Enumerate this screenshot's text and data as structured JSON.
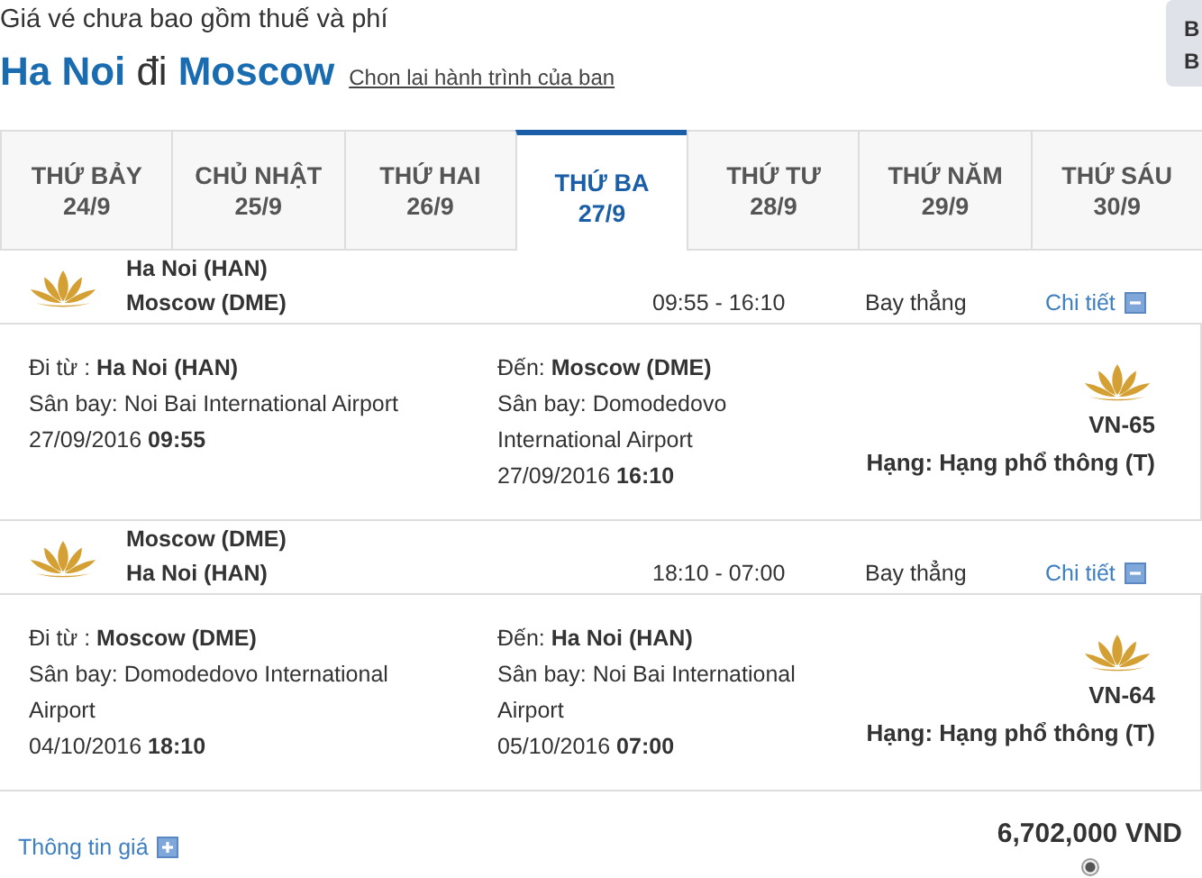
{
  "note": "Giá vé chưa bao gồm thuế và phí",
  "route": {
    "from": "Ha Noi",
    "joiner": "đi",
    "to": "Moscow",
    "change_link": "Chon lai hành trình của ban"
  },
  "tooltip": {
    "lines": [
      "B",
      "B"
    ]
  },
  "tabs": [
    {
      "day": "THỨ BẢY",
      "date": "24/9",
      "selected": false
    },
    {
      "day": "CHỦ NHẬT",
      "date": "25/9",
      "selected": false
    },
    {
      "day": "THỨ HAI",
      "date": "26/9",
      "selected": false
    },
    {
      "day": "THỨ BA",
      "date": "27/9",
      "selected": true
    },
    {
      "day": "THỨ TƯ",
      "date": "28/9",
      "selected": false
    },
    {
      "day": "THỨ NĂM",
      "date": "29/9",
      "selected": false
    },
    {
      "day": "THỨ SÁU",
      "date": "30/9",
      "selected": false
    }
  ],
  "flights": [
    {
      "from": "Ha Noi (HAN)",
      "to": "Moscow (DME)",
      "time": "09:55 - 16:10",
      "stops": "Bay thẳng",
      "detail_link": "Chi tiết",
      "expanded": true,
      "depart": {
        "place": "Đi từ : **Ha Noi (HAN)**",
        "airport": "Sân bay: Noi Bai International Airport",
        "when": "27/09/2016 **09:55**"
      },
      "arrive": {
        "place": "Đến: **Moscow (DME)**",
        "airport": "Sân bay: Domodedovo International Airport",
        "when": "27/09/2016 **16:10**"
      },
      "flight_no": "VN-65",
      "fare_class": "Hạng: Hạng phổ thông (T)"
    },
    {
      "from": "Moscow (DME)",
      "to": "Ha Noi (HAN)",
      "time": "18:10 - 07:00",
      "stops": "Bay thẳng",
      "detail_link": "Chi tiết",
      "expanded": true,
      "depart": {
        "place": "Đi từ : **Moscow (DME)**",
        "airport": "Sân bay: Domodedovo International Airport",
        "when": "04/10/2016 **18:10**"
      },
      "arrive": {
        "place": "Đến: **Ha Noi (HAN)**",
        "airport": "Sân bay: Noi Bai International Airport",
        "when": "05/10/2016 **07:00**"
      },
      "flight_no": "VN-64",
      "fare_class": "Hạng: Hạng phổ thông (T)"
    }
  ],
  "price_info_link": "Thông tin giá",
  "price_info_expanded": false,
  "total": "6,702,000 VND",
  "fare_radio": {
    "selected": true
  }
}
